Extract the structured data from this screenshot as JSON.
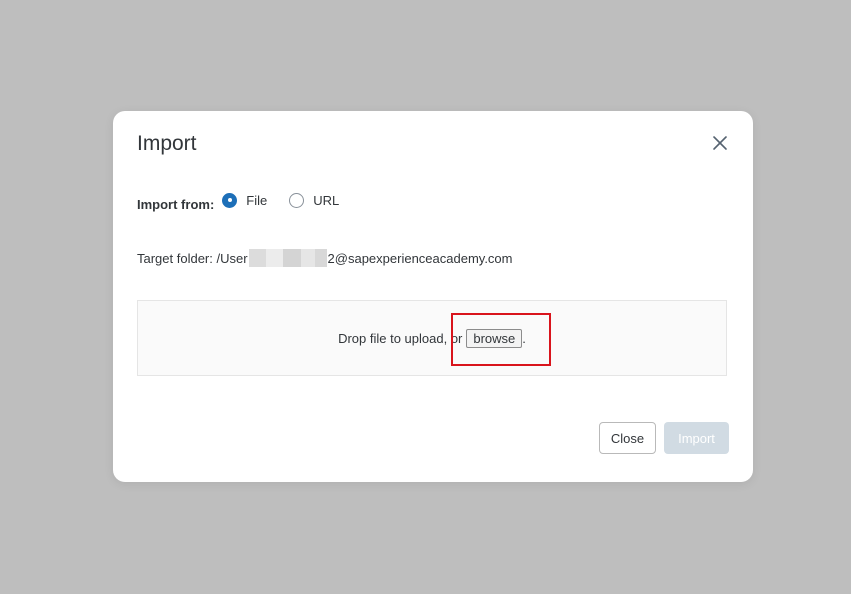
{
  "dialog": {
    "title": "Import",
    "close_icon": "close-icon"
  },
  "import_from": {
    "label": "Import from:",
    "options": [
      {
        "label": "File",
        "checked": true
      },
      {
        "label": "URL",
        "checked": false
      }
    ]
  },
  "target_folder": {
    "prefix": "Target folder: /User",
    "suffix": "2@sapexperienceacademy.com"
  },
  "dropzone": {
    "text": "Drop file to upload, or",
    "browse_label": "browse",
    "trailing": "."
  },
  "footer": {
    "close_label": "Close",
    "import_label": "Import"
  },
  "colors": {
    "overlay": "#bebebe",
    "accent": "#1d6fb8",
    "highlight": "#d9141c",
    "disabled_button": "#d1dbe3"
  }
}
